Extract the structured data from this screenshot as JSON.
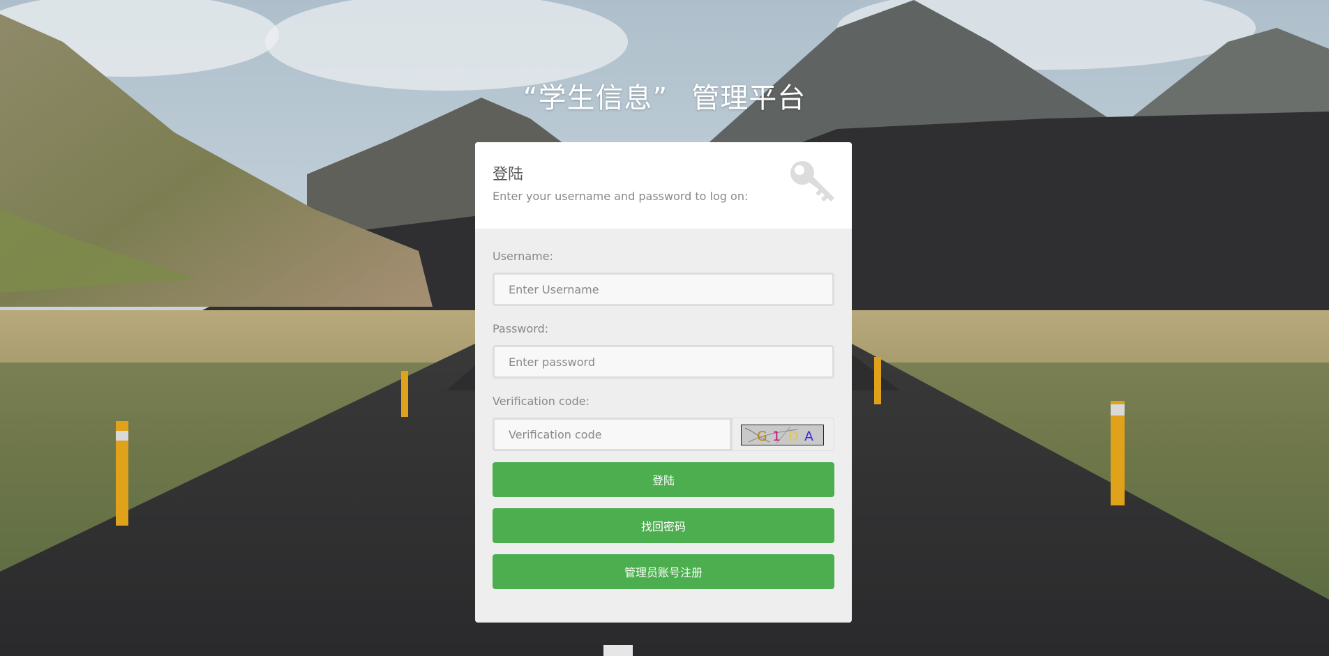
{
  "page": {
    "title_part1": "“学生信息”",
    "title_part2": "管理平台"
  },
  "login": {
    "heading": "登陆",
    "subheading": "Enter your username and password to log on:",
    "username": {
      "label": "Username:",
      "placeholder": "Enter Username",
      "value": ""
    },
    "password": {
      "label": "Password:",
      "placeholder": "Enter password",
      "value": ""
    },
    "verification": {
      "label": "Verification code:",
      "placeholder": "Verification code",
      "value": "",
      "captcha_chars": [
        "G",
        "1",
        "D",
        "A"
      ]
    },
    "buttons": {
      "login": "登陆",
      "recover_password": "找回密码",
      "admin_register": "管理员账号注册"
    }
  },
  "colors": {
    "button_green": "#4cae4f",
    "panel_bg": "#eeeeee",
    "header_bg": "#ffffff"
  },
  "icons": {
    "header_icon": "key-icon"
  }
}
